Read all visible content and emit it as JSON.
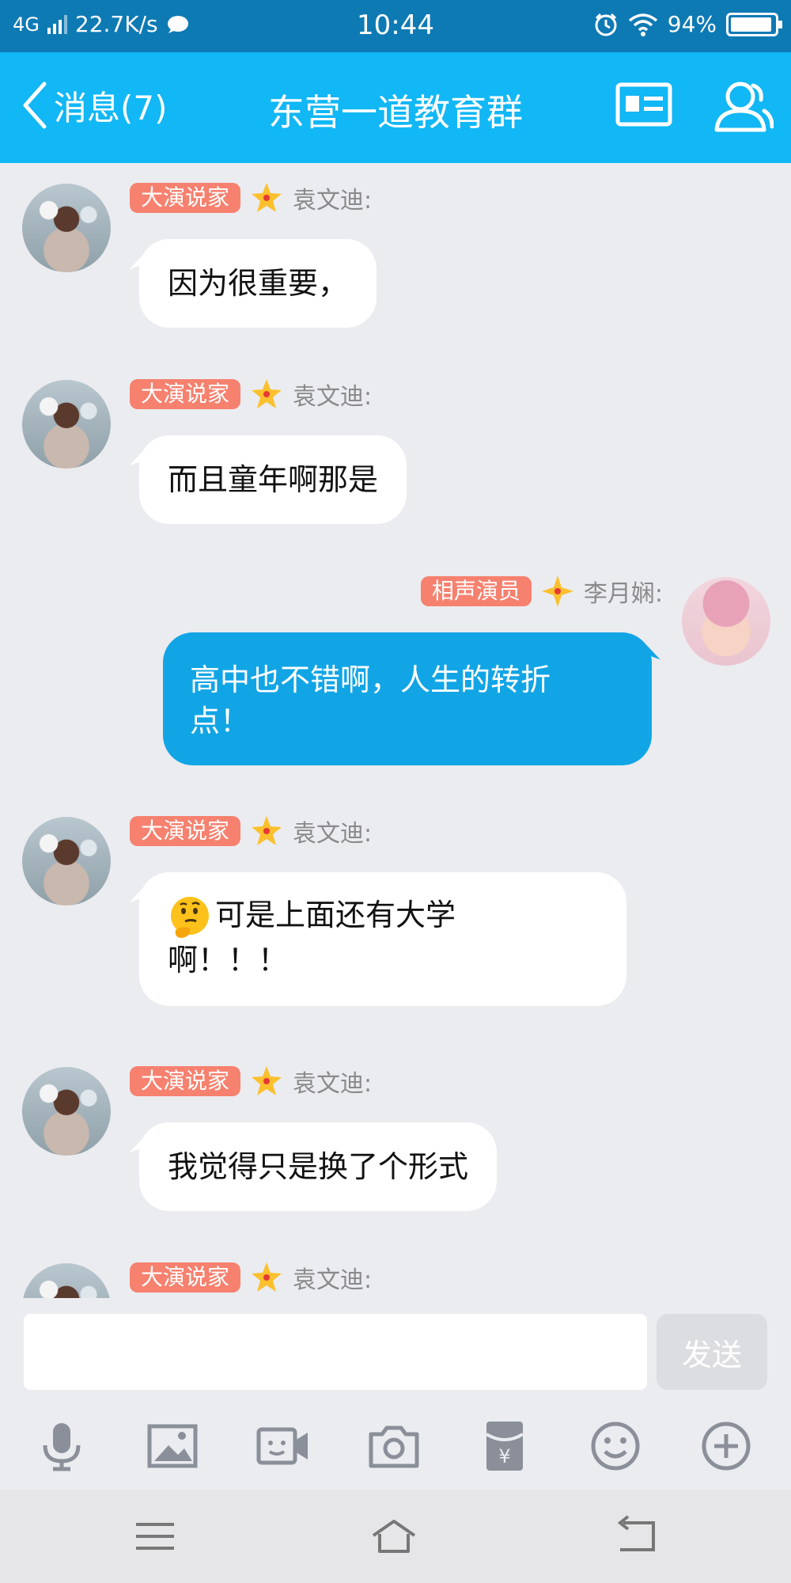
{
  "status_bar": {
    "network": "4G",
    "speed": "22.7K/s",
    "time": "10:44",
    "battery": "94%",
    "battery_level": 0.94
  },
  "header": {
    "back_label": "消息(7)",
    "title": "东营一道教育群",
    "card_icon": "id-card-icon",
    "members_icon": "group-members-icon"
  },
  "colors": {
    "header": "#12b7f5",
    "status": "#0e7ab4",
    "own_bubble": "#12a5e6",
    "badge": "#f6816f"
  },
  "messages": [
    {
      "side": "left",
      "badge": "大演说家",
      "sender": "袁文迪:",
      "lines": [
        "因为很重要，"
      ]
    },
    {
      "side": "left",
      "badge": "大演说家",
      "sender": "袁文迪:",
      "lines": [
        "而且童年啊那是"
      ]
    },
    {
      "side": "right",
      "badge": "相声演员",
      "sender": "李月娴:",
      "lines": [
        "高中也不错啊，人生的转折",
        "点！"
      ]
    },
    {
      "side": "left",
      "badge": "大演说家",
      "sender": "袁文迪:",
      "emoji": "thinking-face",
      "lines": [
        "可是上面还有大学",
        "啊！！！"
      ]
    },
    {
      "side": "left",
      "badge": "大演说家",
      "sender": "袁文迪:",
      "lines": [
        "我觉得只是换了个形式"
      ]
    },
    {
      "side": "left",
      "badge": "大演说家",
      "sender": "袁文迪:",
      "lines": []
    }
  ],
  "input": {
    "value": "",
    "send_label": "发送"
  },
  "toolbar": [
    "microphone-icon",
    "image-icon",
    "video-call-icon",
    "camera-icon",
    "red-packet-icon",
    "emoji-icon",
    "plus-icon"
  ],
  "system_nav": [
    "menu-icon",
    "home-icon",
    "back-icon"
  ]
}
